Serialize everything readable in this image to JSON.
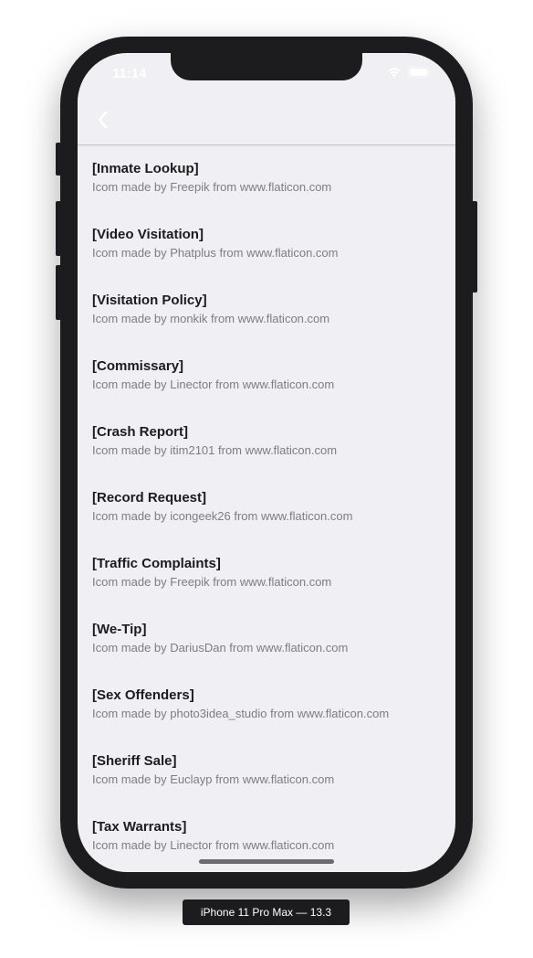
{
  "status_bar": {
    "time": "11:14"
  },
  "nav": {
    "back_icon": "chevron-left-icon"
  },
  "items": [
    {
      "title": "[Inmate Lookup]",
      "credit": "Icom made by Freepik from www.flaticon.com"
    },
    {
      "title": "[Video Visitation]",
      "credit": "Icom made by Phatplus from www.flaticon.com"
    },
    {
      "title": "[Visitation Policy]",
      "credit": "Icom made by monkik from www.flaticon.com"
    },
    {
      "title": "[Commissary]",
      "credit": "Icom made by Linector from www.flaticon.com"
    },
    {
      "title": "[Crash Report]",
      "credit": "Icom made by itim2101 from www.flaticon.com"
    },
    {
      "title": "[Record Request]",
      "credit": "Icom made by icongeek26 from www.flaticon.com"
    },
    {
      "title": "[Traffic Complaints]",
      "credit": "Icom made by Freepik from www.flaticon.com"
    },
    {
      "title": "[We-Tip]",
      "credit": "Icom made by DariusDan from www.flaticon.com"
    },
    {
      "title": "[Sex Offenders]",
      "credit": "Icom made by photo3idea_studio from www.flaticon.com"
    },
    {
      "title": "[Sheriff Sale]",
      "credit": "Icom made by Euclayp from www.flaticon.com"
    },
    {
      "title": "[Tax Warrants]",
      "credit": "Icom made by Linector from www.flaticon.com"
    }
  ],
  "device_label": "iPhone 11 Pro Max — 13.3",
  "colors": {
    "background": "#efeff4",
    "title": "#1c1c1e",
    "credit": "#7d7d82",
    "device_frame": "#1c1c1e"
  }
}
